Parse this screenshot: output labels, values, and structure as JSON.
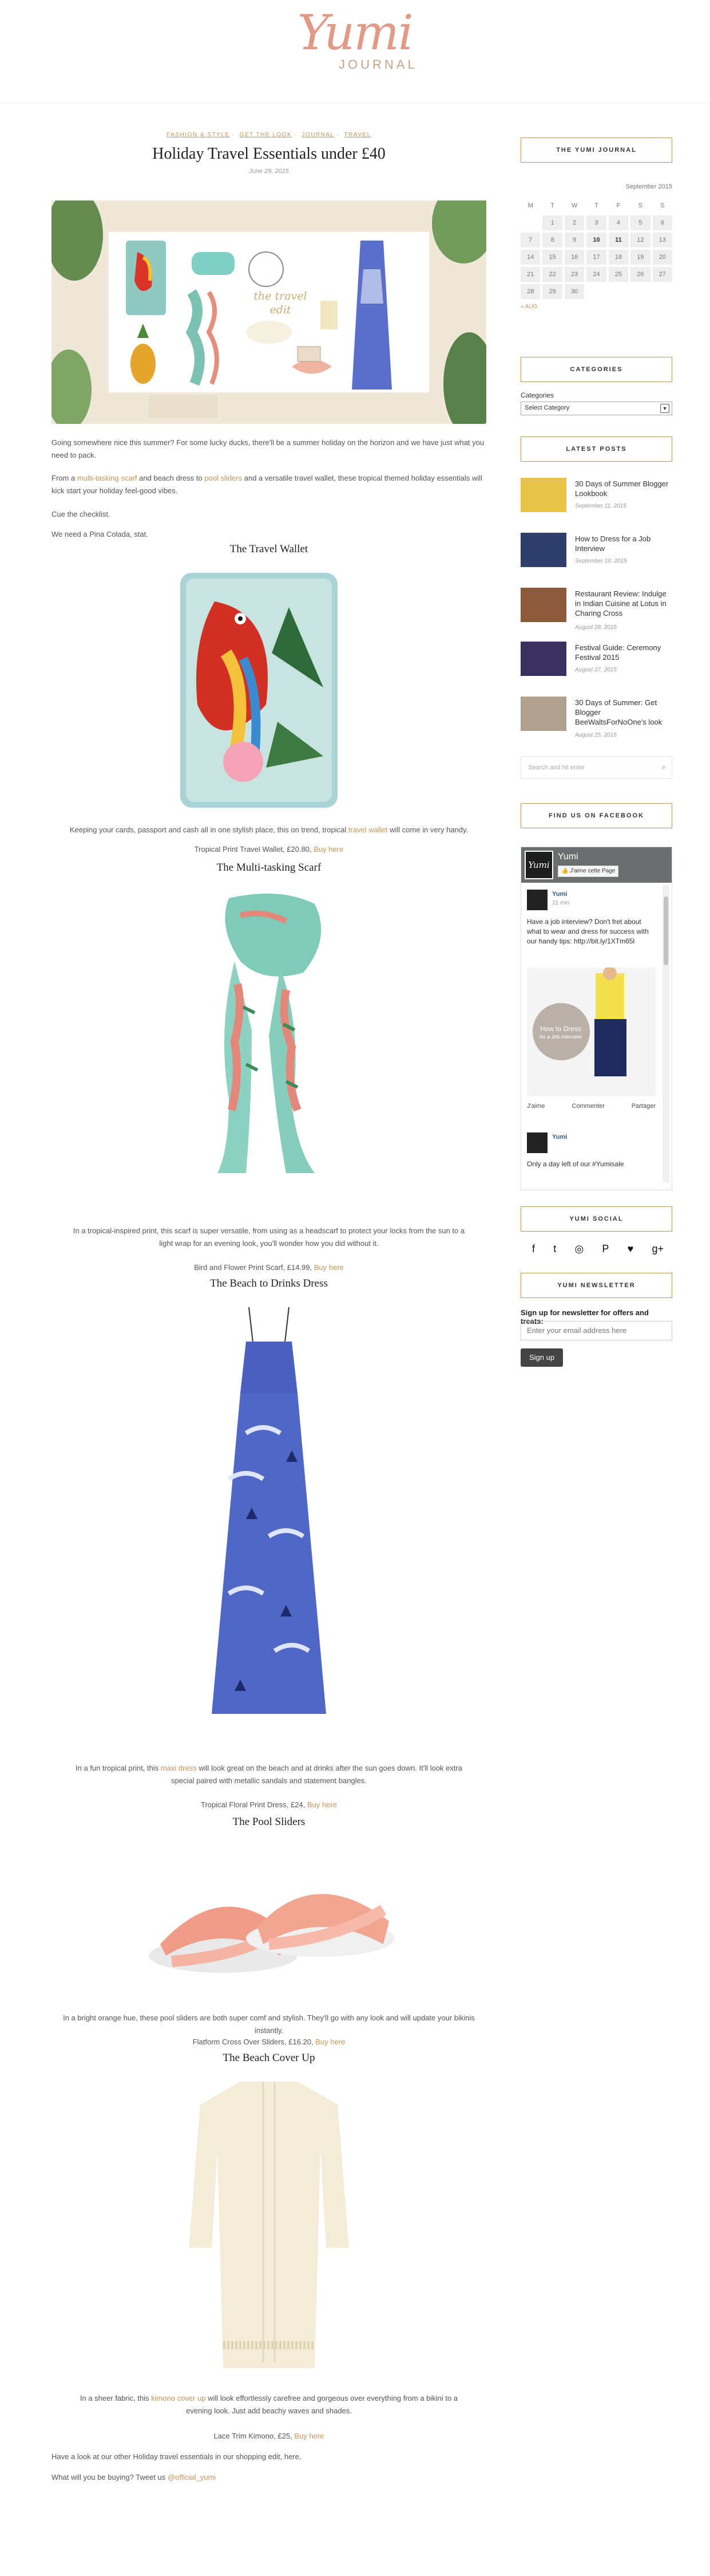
{
  "site": {
    "logo_script": "Yumi",
    "logo_sub": "JOURNAL"
  },
  "post": {
    "categories": [
      "FASHION & STYLE",
      "GET THE LOOK",
      "JOURNAL",
      "TRAVEL"
    ],
    "title": "Holiday Travel Essentials under £40",
    "date": "June 29, 2015",
    "intro1": "Going somewhere nice this summer? For some lucky ducks, there'll be a summer holiday on the horizon and we have just what you need to pack.",
    "intro2_a": "From a ",
    "intro2_link1": "multi-tasking scarf",
    "intro2_b": " and beach dress to ",
    "intro2_link2": "pool sliders",
    "intro2_c": " and a versatile travel wallet, these tropical themed holiday essentials will kick start your holiday feel-good vibes.",
    "intro3": "Cue the checklist.",
    "intro4": "We need a Pina Colada, stat.",
    "hero_text": "the travel edit",
    "buy_here": "Buy here",
    "sections": [
      {
        "title": "The Travel Wallet",
        "desc_a": "Keeping your cards, passport and cash all in one stylish place, this on trend, tropical ",
        "desc_link": "travel wallet",
        "desc_b": " will come in very handy.",
        "price": "Tropical Print Travel Wallet, £20.80, "
      },
      {
        "title": "The Multi-tasking Scarf",
        "desc_a": "In a tropical-inspired print, this scarf is super versatile, from using as a headscarf to protect your locks from the sun to a light wrap for an evening look, you'll wonder how you did without it.",
        "desc_link": "",
        "desc_b": "",
        "price": "Bird and Flower Print Scarf, £14.99, "
      },
      {
        "title": "The Beach to Drinks Dress",
        "desc_a": "In a fun tropical print, this ",
        "desc_link": "maxi dress",
        "desc_b": " will look great on the beach and at drinks after the sun goes down. It'll look extra special paired with metallic sandals and statement bangles.",
        "price": "Tropical Floral Print Dress, £24, "
      },
      {
        "title": "The Pool Sliders",
        "desc_a": "In a bright orange hue, these pool sliders are both super comf and stylish. They'll go with any look and will update your bikinis instantly.",
        "desc_link": "",
        "desc_b": "",
        "price": "Flatform Cross Over Sliders, £16.20, "
      },
      {
        "title": "The Beach Cover Up",
        "desc_a": "In a sheer fabric, this ",
        "desc_link": "kimono cover up",
        "desc_b": " will look effortlessly carefree and gorgeous over everything from a bikini to a evening look. Just add beachy waves and shades.",
        "price": "Lace Trim Kimono, £25, "
      }
    ],
    "outro1": "Have a look at our other Holiday travel essentials in our shopping edit, here.",
    "outro2_a": "What will you be buying? Tweet us ",
    "outro2_link": "@official_yumi"
  },
  "sidebar": {
    "journal_title": "THE YUMI JOURNAL",
    "calendar": {
      "month": "September 2015",
      "days": [
        "M",
        "T",
        "W",
        "T",
        "F",
        "S",
        "S"
      ],
      "cells": [
        "",
        "1",
        "2",
        "3",
        "4",
        "5",
        "6",
        "7",
        "8",
        "9",
        "10",
        "11",
        "12",
        "13",
        "14",
        "15",
        "16",
        "17",
        "18",
        "19",
        "20",
        "21",
        "22",
        "23",
        "24",
        "25",
        "26",
        "27",
        "28",
        "29",
        "30",
        "",
        "",
        "",
        ""
      ],
      "linked": [
        "10",
        "11"
      ],
      "prev": "« AUG"
    },
    "categories_title": "CATEGORIES",
    "categories_label": "Categories",
    "categories_select": "Select Category",
    "latest_title": "LATEST POSTS",
    "latest": [
      {
        "title": "30 Days of Summer Blogger Lookbook",
        "date": "September 11, 2015",
        "color": "#e8c34a"
      },
      {
        "title": "How to Dress for a Job Interview",
        "date": "September 10, 2015",
        "color": "#2f3d6b"
      },
      {
        "title": "Restaurant Review: Indulge in Indian Cuisine at Lotus in Charing Cross",
        "date": "August 28, 2015",
        "color": "#8a5a3a"
      },
      {
        "title": "Festival Guide: Ceremony Festival 2015",
        "date": "August 27, 2015",
        "color": "#3a3060"
      },
      {
        "title": "30 Days of Summer: Get Blogger BeeWaltsForNoOne's look",
        "date": "August 25, 2015",
        "color": "#b0a090"
      }
    ],
    "search_placeholder": "Search and hit enter",
    "facebook_title": "FIND US ON FACEBOOK",
    "fb": {
      "page_name": "Yumi",
      "like_btn": "J'aime cette Page",
      "post_author": "Yumi",
      "post_time": "21 min",
      "post_text": "Have a job interview? Don't fret about what to wear and dress for success with our handy tips: http://bit.ly/1XTm65l",
      "card_title": "How to Dress",
      "card_sub": "for a Job Interview",
      "actions": [
        "J'aime",
        "Commenter",
        "Partager"
      ],
      "post2_author": "Yumi",
      "post2_text": "Only a day left of our #Yumisale"
    },
    "social_title": "YUMI SOCIAL",
    "social_icons": [
      "f",
      "t",
      "◎",
      "P",
      "♥",
      "g+"
    ],
    "newsletter_title": "YUMI NEWSLETTER",
    "newsletter_label": "Sign up for newsletter for offers and treats:",
    "newsletter_placeholder": "Enter your email address here",
    "newsletter_button": "Sign up"
  }
}
